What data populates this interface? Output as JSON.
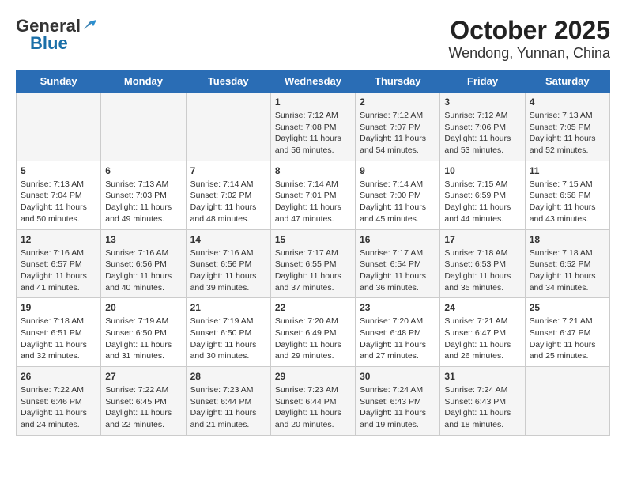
{
  "header": {
    "logo_general": "General",
    "logo_blue": "Blue",
    "title": "October 2025",
    "subtitle": "Wendong, Yunnan, China"
  },
  "days_of_week": [
    "Sunday",
    "Monday",
    "Tuesday",
    "Wednesday",
    "Thursday",
    "Friday",
    "Saturday"
  ],
  "weeks": [
    {
      "days": [
        {
          "num": "",
          "detail": ""
        },
        {
          "num": "",
          "detail": ""
        },
        {
          "num": "",
          "detail": ""
        },
        {
          "num": "1",
          "detail": "Sunrise: 7:12 AM\nSunset: 7:08 PM\nDaylight: 11 hours\nand 56 minutes."
        },
        {
          "num": "2",
          "detail": "Sunrise: 7:12 AM\nSunset: 7:07 PM\nDaylight: 11 hours\nand 54 minutes."
        },
        {
          "num": "3",
          "detail": "Sunrise: 7:12 AM\nSunset: 7:06 PM\nDaylight: 11 hours\nand 53 minutes."
        },
        {
          "num": "4",
          "detail": "Sunrise: 7:13 AM\nSunset: 7:05 PM\nDaylight: 11 hours\nand 52 minutes."
        }
      ]
    },
    {
      "days": [
        {
          "num": "5",
          "detail": "Sunrise: 7:13 AM\nSunset: 7:04 PM\nDaylight: 11 hours\nand 50 minutes."
        },
        {
          "num": "6",
          "detail": "Sunrise: 7:13 AM\nSunset: 7:03 PM\nDaylight: 11 hours\nand 49 minutes."
        },
        {
          "num": "7",
          "detail": "Sunrise: 7:14 AM\nSunset: 7:02 PM\nDaylight: 11 hours\nand 48 minutes."
        },
        {
          "num": "8",
          "detail": "Sunrise: 7:14 AM\nSunset: 7:01 PM\nDaylight: 11 hours\nand 47 minutes."
        },
        {
          "num": "9",
          "detail": "Sunrise: 7:14 AM\nSunset: 7:00 PM\nDaylight: 11 hours\nand 45 minutes."
        },
        {
          "num": "10",
          "detail": "Sunrise: 7:15 AM\nSunset: 6:59 PM\nDaylight: 11 hours\nand 44 minutes."
        },
        {
          "num": "11",
          "detail": "Sunrise: 7:15 AM\nSunset: 6:58 PM\nDaylight: 11 hours\nand 43 minutes."
        }
      ]
    },
    {
      "days": [
        {
          "num": "12",
          "detail": "Sunrise: 7:16 AM\nSunset: 6:57 PM\nDaylight: 11 hours\nand 41 minutes."
        },
        {
          "num": "13",
          "detail": "Sunrise: 7:16 AM\nSunset: 6:56 PM\nDaylight: 11 hours\nand 40 minutes."
        },
        {
          "num": "14",
          "detail": "Sunrise: 7:16 AM\nSunset: 6:56 PM\nDaylight: 11 hours\nand 39 minutes."
        },
        {
          "num": "15",
          "detail": "Sunrise: 7:17 AM\nSunset: 6:55 PM\nDaylight: 11 hours\nand 37 minutes."
        },
        {
          "num": "16",
          "detail": "Sunrise: 7:17 AM\nSunset: 6:54 PM\nDaylight: 11 hours\nand 36 minutes."
        },
        {
          "num": "17",
          "detail": "Sunrise: 7:18 AM\nSunset: 6:53 PM\nDaylight: 11 hours\nand 35 minutes."
        },
        {
          "num": "18",
          "detail": "Sunrise: 7:18 AM\nSunset: 6:52 PM\nDaylight: 11 hours\nand 34 minutes."
        }
      ]
    },
    {
      "days": [
        {
          "num": "19",
          "detail": "Sunrise: 7:18 AM\nSunset: 6:51 PM\nDaylight: 11 hours\nand 32 minutes."
        },
        {
          "num": "20",
          "detail": "Sunrise: 7:19 AM\nSunset: 6:50 PM\nDaylight: 11 hours\nand 31 minutes."
        },
        {
          "num": "21",
          "detail": "Sunrise: 7:19 AM\nSunset: 6:50 PM\nDaylight: 11 hours\nand 30 minutes."
        },
        {
          "num": "22",
          "detail": "Sunrise: 7:20 AM\nSunset: 6:49 PM\nDaylight: 11 hours\nand 29 minutes."
        },
        {
          "num": "23",
          "detail": "Sunrise: 7:20 AM\nSunset: 6:48 PM\nDaylight: 11 hours\nand 27 minutes."
        },
        {
          "num": "24",
          "detail": "Sunrise: 7:21 AM\nSunset: 6:47 PM\nDaylight: 11 hours\nand 26 minutes."
        },
        {
          "num": "25",
          "detail": "Sunrise: 7:21 AM\nSunset: 6:47 PM\nDaylight: 11 hours\nand 25 minutes."
        }
      ]
    },
    {
      "days": [
        {
          "num": "26",
          "detail": "Sunrise: 7:22 AM\nSunset: 6:46 PM\nDaylight: 11 hours\nand 24 minutes."
        },
        {
          "num": "27",
          "detail": "Sunrise: 7:22 AM\nSunset: 6:45 PM\nDaylight: 11 hours\nand 22 minutes."
        },
        {
          "num": "28",
          "detail": "Sunrise: 7:23 AM\nSunset: 6:44 PM\nDaylight: 11 hours\nand 21 minutes."
        },
        {
          "num": "29",
          "detail": "Sunrise: 7:23 AM\nSunset: 6:44 PM\nDaylight: 11 hours\nand 20 minutes."
        },
        {
          "num": "30",
          "detail": "Sunrise: 7:24 AM\nSunset: 6:43 PM\nDaylight: 11 hours\nand 19 minutes."
        },
        {
          "num": "31",
          "detail": "Sunrise: 7:24 AM\nSunset: 6:43 PM\nDaylight: 11 hours\nand 18 minutes."
        },
        {
          "num": "",
          "detail": ""
        }
      ]
    }
  ]
}
